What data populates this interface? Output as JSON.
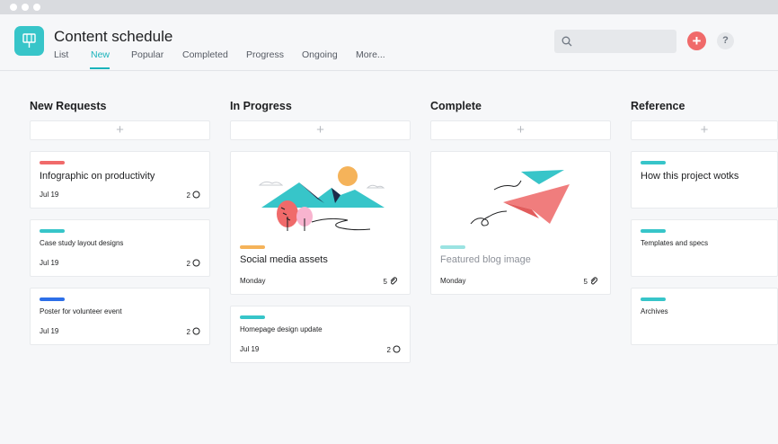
{
  "window": {
    "traffic_lights": [
      "dot",
      "dot",
      "dot"
    ]
  },
  "app": {
    "title": "Content schedule",
    "icon": "board-icon",
    "accent": "#37c5c9"
  },
  "tabs": [
    {
      "label": "List",
      "active": false
    },
    {
      "label": "New",
      "active": true
    },
    {
      "label": "Popular",
      "active": false
    },
    {
      "label": "Completed",
      "active": false
    },
    {
      "label": "Progress",
      "active": false
    },
    {
      "label": "Ongoing",
      "active": false
    },
    {
      "label": "More...",
      "active": false
    }
  ],
  "toolbar": {
    "search_icon": "search-icon",
    "add_label": "+",
    "help_label": "?",
    "add_color": "#f06a6a"
  },
  "columns": [
    {
      "title": "New Requests",
      "add_label": "+",
      "cards": [
        {
          "title": "Infographic on productivity",
          "date": "Jul 19",
          "count": "2",
          "count_icon": "comment-icon",
          "tag_color": "#f06a6a"
        },
        {
          "title": "Case study layout designs",
          "date": "Jul 19",
          "count": "2",
          "count_icon": "comment-icon",
          "tag_color": "#37c5c9"
        },
        {
          "title": "Poster for volunteer event",
          "date": "Jul 19",
          "count": "2",
          "count_icon": "comment-icon",
          "tag_color": "#2d6fe8"
        }
      ]
    },
    {
      "title": "In Progress",
      "add_label": "+",
      "cards": [
        {
          "title": "Social media assets",
          "date": "Monday",
          "count": "5",
          "count_icon": "attachment-icon",
          "tag_color": "#f5b35a",
          "image": "mountain-illustration"
        },
        {
          "title": "Homepage design update",
          "date": "Jul 19",
          "count": "2",
          "count_icon": "comment-icon",
          "tag_color": "#37c5c9"
        }
      ]
    },
    {
      "title": "Complete",
      "add_label": "+",
      "cards": [
        {
          "title": "Featured blog image",
          "date": "Monday",
          "count": "5",
          "count_icon": "attachment-icon",
          "tag_color": "#9be3e2",
          "image": "paper-plane-illustration"
        }
      ]
    },
    {
      "title": "Reference",
      "add_label": "+",
      "cards": [
        {
          "title": "How this project wotks",
          "tag_color": "#37c5c9"
        },
        {
          "title": "Templates and specs",
          "tag_color": "#37c5c9"
        },
        {
          "title": "Archives",
          "tag_color": "#37c5c9"
        }
      ]
    }
  ]
}
